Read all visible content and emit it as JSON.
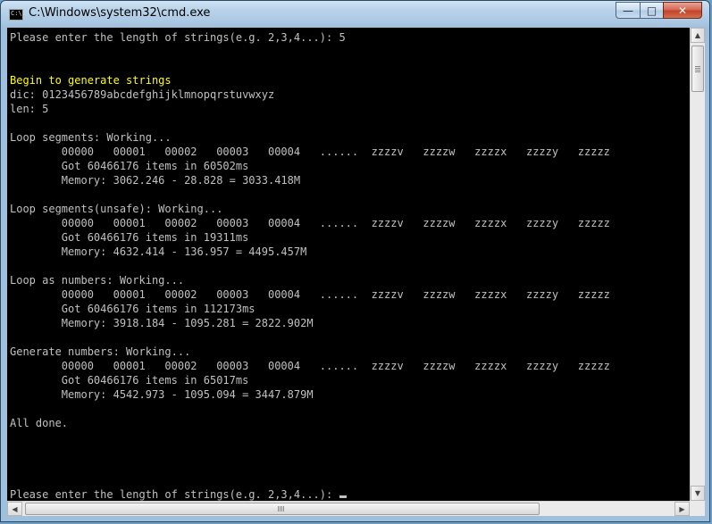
{
  "window": {
    "title": "C:\\Windows\\system32\\cmd.exe",
    "icon_label": "C:\\.",
    "buttons": {
      "minimize": "—",
      "maximize": "□",
      "close": "✕"
    }
  },
  "console": {
    "text_color": "#c0c0c0",
    "highlight_color": "#ffff00",
    "background": "#000000",
    "lines": [
      "Please enter the length of strings(e.g. 2,3,4...): 5",
      "",
      "",
      "Begin to generate strings",
      "dic: 0123456789abcdefghijklmnopqrstuvwxyz",
      "len: 5",
      "",
      "Loop segments: Working...",
      "        00000   00001   00002   00003   00004   ......  zzzzv   zzzzw   zzzzx   zzzzy   zzzzz",
      "        Got 60466176 items in 60502ms",
      "        Memory: 3062.246 - 28.828 = 3033.418M",
      "",
      "Loop segments(unsafe): Working...",
      "        00000   00001   00002   00003   00004   ......  zzzzv   zzzzw   zzzzx   zzzzy   zzzzz",
      "        Got 60466176 items in 19311ms",
      "        Memory: 4632.414 - 136.957 = 4495.457M",
      "",
      "Loop as numbers: Working...",
      "        00000   00001   00002   00003   00004   ......  zzzzv   zzzzw   zzzzx   zzzzy   zzzzz",
      "        Got 60466176 items in 112173ms",
      "        Memory: 3918.184 - 1095.281 = 2822.902M",
      "",
      "Generate numbers: Working...",
      "        00000   00001   00002   00003   00004   ......  zzzzv   zzzzw   zzzzx   zzzzy   zzzzz",
      "        Got 60466176 items in 65017ms",
      "        Memory: 4542.973 - 1095.094 = 3447.879M",
      "",
      "All done.",
      "",
      "",
      "",
      "",
      "Please enter the length of strings(e.g. 2,3,4...): "
    ],
    "highlight_lines": [
      3
    ]
  },
  "scrollbars": {
    "up_arrow": "▲",
    "down_arrow": "▼",
    "left_arrow": "◀",
    "right_arrow": "▶"
  }
}
